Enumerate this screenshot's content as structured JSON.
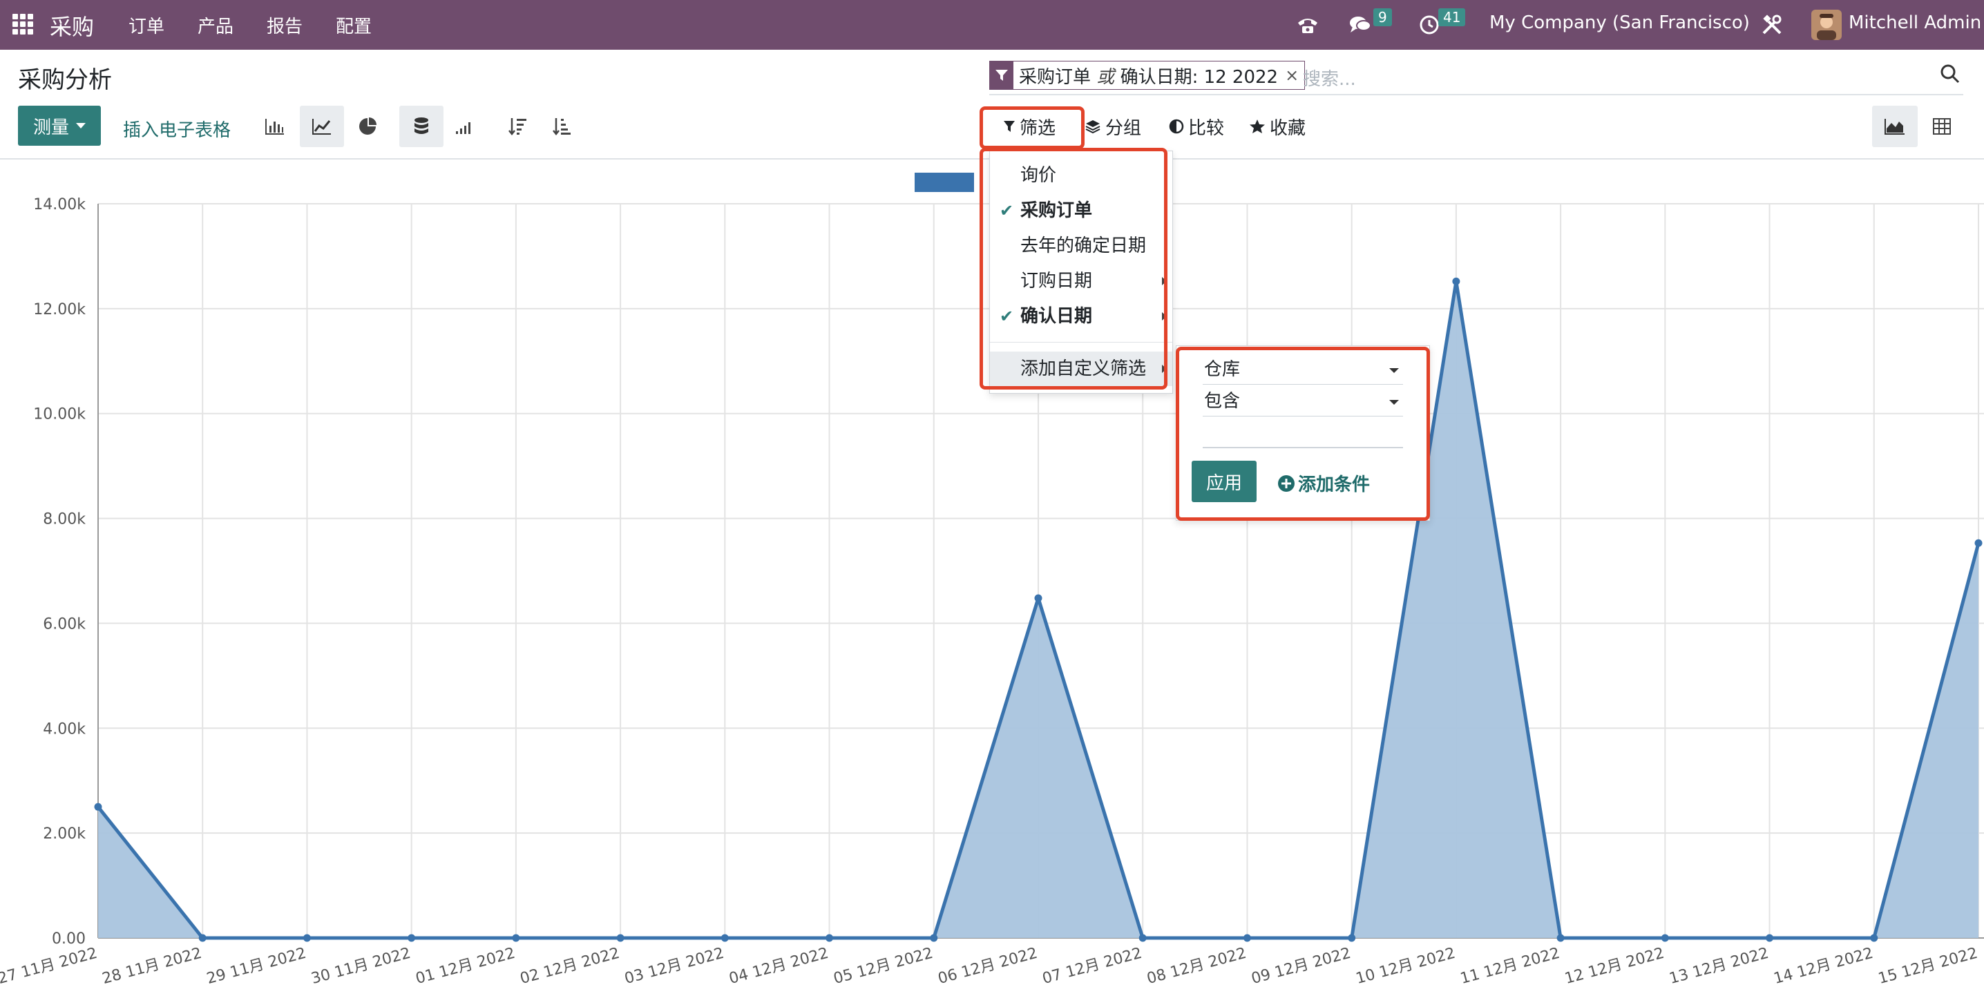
{
  "navbar": {
    "app_name": "采购",
    "menu": [
      "订单",
      "产品",
      "报告",
      "配置"
    ],
    "messages_count": "9",
    "activities_count": "41",
    "company": "My Company (San Francisco)",
    "user": "Mitchell Admin"
  },
  "control_panel": {
    "title": "采购分析",
    "measure_label": "测量",
    "insert_sheet_label": "插入电子表格",
    "search": {
      "facet_part1": "采购订单",
      "facet_or": "或",
      "facet_part2": "确认日期: 12 2022",
      "facet_close": "×",
      "placeholder": "搜索..."
    },
    "filter_label": "筛选",
    "groupby_label": "分组",
    "compare_label": "比较",
    "favorites_label": "收藏"
  },
  "filter_menu": {
    "items": [
      {
        "label": "询价",
        "checked": false
      },
      {
        "label": "采购订单",
        "checked": true
      },
      {
        "label": "去年的确定日期",
        "checked": false
      },
      {
        "label": "订购日期",
        "checked": false
      },
      {
        "label": "确认日期",
        "checked": true
      }
    ],
    "add_custom_label": "添加自定义筛选"
  },
  "custom_filter": {
    "field": "仓库",
    "operator": "包含",
    "value": "",
    "apply_label": "应用",
    "add_condition_label": "添加条件"
  },
  "colors": {
    "navbar": "#6f4c6d",
    "primary": "#2f7d7a",
    "series_line": "#3a73ad",
    "series_fill": "#a9c4de",
    "highlight": "#e2432a"
  },
  "chart_data": {
    "type": "area",
    "categories": [
      "27 11月 2022",
      "28 11月 2022",
      "29 11月 2022",
      "30 11月 2022",
      "01 12月 2022",
      "02 12月 2022",
      "03 12月 2022",
      "04 12月 2022",
      "05 12月 2022",
      "06 12月 2022",
      "07 12月 2022",
      "08 12月 2022",
      "09 12月 2022",
      "10 12月 2022",
      "11 12月 2022",
      "12 12月 2022",
      "13 12月 2022",
      "14 12月 2022",
      "15 12月 2022"
    ],
    "series": [
      {
        "values": [
          2500,
          0,
          0,
          0,
          0,
          0,
          0,
          0,
          0,
          6480,
          0,
          0,
          0,
          12520,
          0,
          0,
          0,
          0,
          7530
        ]
      }
    ],
    "yticks": [
      "0.00",
      "2.00k",
      "4.00k",
      "6.00k",
      "8.00k",
      "10.00k",
      "12.00k",
      "14.00k"
    ],
    "ylim": [
      0,
      14000
    ],
    "grid": true,
    "legend_position": "top-center"
  }
}
